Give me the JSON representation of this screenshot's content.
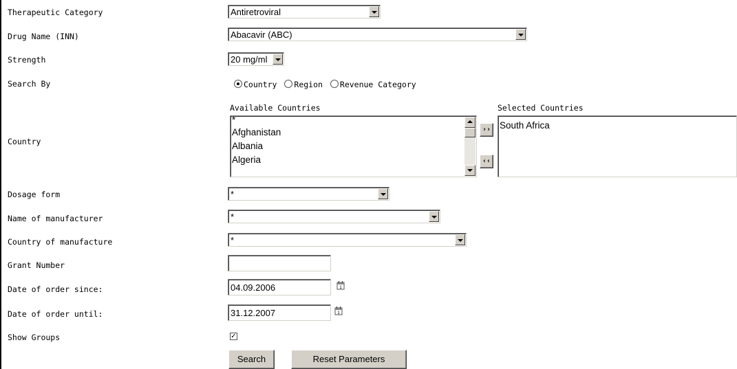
{
  "labels": {
    "therapeutic_category": "Therapeutic Category",
    "drug_name": "Drug Name (INN)",
    "strength": "Strength",
    "search_by": "Search By",
    "country": "Country",
    "dosage_form": "Dosage form",
    "manufacturer": "Name of manufacturer",
    "country_of_manufacture": "Country of manufacture",
    "grant_number": "Grant Number",
    "date_since": "Date of order since:",
    "date_until": "Date of order until:",
    "show_groups": "Show Groups"
  },
  "fields": {
    "therapeutic_category": "Antiretroviral",
    "drug_name": "Abacavir (ABC)",
    "strength": "20 mg/ml",
    "dosage_form": "*",
    "manufacturer": "*",
    "country_of_manufacture": "*",
    "grant_number": "",
    "date_since": "04.09.2006",
    "date_until": "31.12.2007",
    "show_groups_checked": true
  },
  "search_by": {
    "options": [
      "Country",
      "Region",
      "Revenue Category"
    ],
    "selected": "Country"
  },
  "countries": {
    "available_header": "Available Countries",
    "selected_header": "Selected Countries",
    "available": [
      "*",
      "Afghanistan",
      "Albania",
      "Algeria"
    ],
    "selected": [
      "South Africa"
    ],
    "add_label": "››",
    "remove_label": "‹‹"
  },
  "buttons": {
    "search": "Search",
    "reset": "Reset Parameters"
  }
}
